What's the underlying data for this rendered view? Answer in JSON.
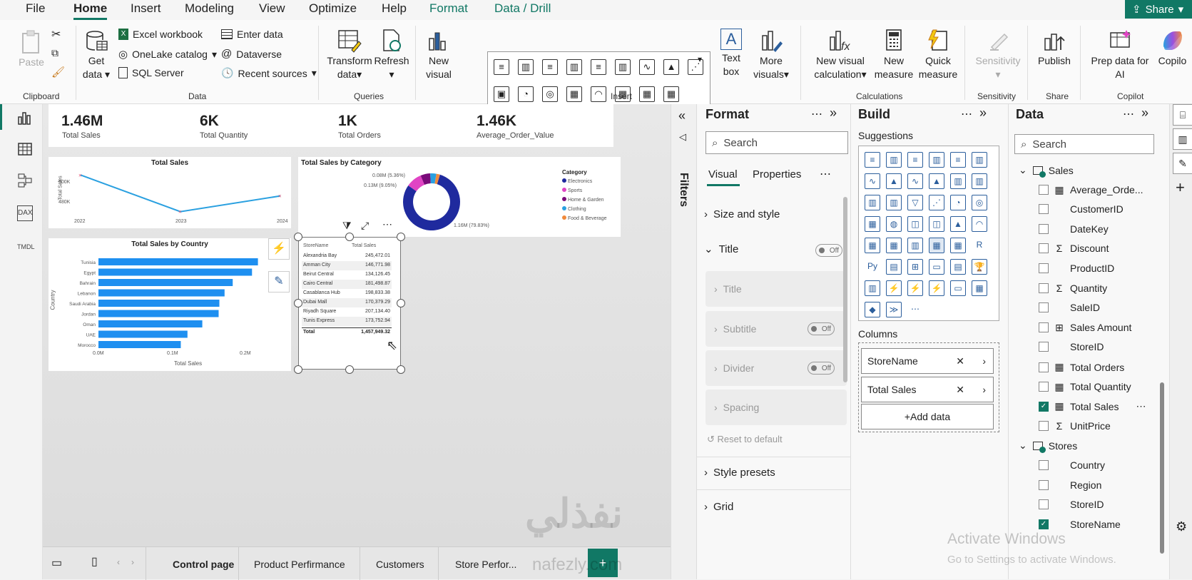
{
  "menu": {
    "file": "File",
    "home": "Home",
    "insert": "Insert",
    "modeling": "Modeling",
    "view": "View",
    "optimize": "Optimize",
    "help": "Help",
    "format": "Format",
    "data_drill": "Data / Drill",
    "share": "Share"
  },
  "ribbon": {
    "paste": "Paste",
    "clipboard": "Clipboard",
    "get_data": "Get",
    "get_data2": "data",
    "excel": "Excel workbook",
    "onelake": "OneLake catalog",
    "sql": "SQL Server",
    "enter_data": "Enter data",
    "dataverse": "Dataverse",
    "recent": "Recent sources",
    "data_group": "Data",
    "transform": "Transform",
    "transform2": "data",
    "refresh": "Refresh",
    "queries": "Queries",
    "new_visual": "New",
    "new_visual2": "visual",
    "text_box": "Text",
    "text_box2": "box",
    "more_visuals": "More",
    "more_visuals2": "visuals",
    "insert_group": "Insert",
    "new_visual_calc": "New visual",
    "new_visual_calc2": "calculation",
    "new_measure": "New",
    "new_measure2": "measure",
    "quick_measure": "Quick",
    "quick_measure2": "measure",
    "calculations": "Calculations",
    "sensitivity": "Sensitivity",
    "sensitivity_group": "Sensitivity",
    "publish": "Publish",
    "share_group": "Share",
    "copilot": "Prep data for",
    "copilot2": "AI",
    "copilot_btn": "Copilo",
    "copilot_group": "Copilot"
  },
  "leftbar": {
    "dax": "DAX",
    "tmdl": "TMDL"
  },
  "kpis": [
    {
      "value": "1.46M",
      "label": "Total Sales"
    },
    {
      "value": "6K",
      "label": "Total Quantity"
    },
    {
      "value": "1K",
      "label": "Total Orders"
    },
    {
      "value": "1.46K",
      "label": "Average_Order_Value"
    }
  ],
  "line_chart": {
    "title": "Total Sales",
    "ylabel": "Total Sales",
    "yticks": [
      "500K",
      "480K"
    ],
    "xticks": [
      "2022",
      "2023",
      "2024"
    ]
  },
  "donut": {
    "title": "Total Sales by Category",
    "legend_title": "Category",
    "labels": [
      "0.08M (5.36%)",
      "0.13M (9.05%)",
      "1.16M (79.83%)"
    ],
    "legend": [
      {
        "name": "Electronics",
        "color": "#1f2a9e"
      },
      {
        "name": "Sports",
        "color": "#e044c4"
      },
      {
        "name": "Home & Garden",
        "color": "#7a0a7a"
      },
      {
        "name": "Clothing",
        "color": "#2aa0e0"
      },
      {
        "name": "Food & Beverage",
        "color": "#f08a3c"
      }
    ]
  },
  "bar_chart": {
    "title": "Total Sales by Country",
    "ylabel": "Country",
    "xlabel": "Total Sales",
    "countries": [
      "Tunisia",
      "Egypt",
      "Bahrain",
      "Lebanon",
      "Saudi Arabia",
      "Jordan",
      "Oman",
      "UAE",
      "Morocco"
    ],
    "xticks": [
      "0.0M",
      "0.1M",
      "0.2M"
    ]
  },
  "chart_data": [
    {
      "type": "line",
      "title": "Total Sales",
      "xlabel": "",
      "ylabel": "Total Sales",
      "x": [
        "2022",
        "2023",
        "2024"
      ],
      "series": [
        {
          "values": [
            505000,
            470000,
            485000
          ]
        }
      ],
      "ylim": [
        465000,
        510000
      ]
    },
    {
      "type": "pie",
      "title": "Total Sales by Category",
      "categories": [
        "Electronics",
        "Sports",
        "Home & Garden",
        "Clothing",
        "Food & Beverage"
      ],
      "values": [
        1.16,
        0.13,
        0.08,
        0.05,
        0.03
      ]
    },
    {
      "type": "bar",
      "title": "Total Sales by Country",
      "xlabel": "Total Sales",
      "ylabel": "Country",
      "categories": [
        "Tunisia",
        "Egypt",
        "Bahrain",
        "Lebanon",
        "Saudi Arabia",
        "Jordan",
        "Oman",
        "UAE",
        "Morocco"
      ],
      "values": [
        0.215,
        0.207,
        0.181,
        0.17,
        0.163,
        0.162,
        0.14,
        0.12,
        0.111
      ],
      "xlim": [
        0,
        0.25
      ]
    }
  ],
  "table": {
    "headers": [
      "StoreName",
      "Total Sales"
    ],
    "rows": [
      [
        "Alexandria Bay",
        "245,472.01"
      ],
      [
        "Amman City",
        "146,771.98"
      ],
      [
        "Beirut Central",
        "134,126.45"
      ],
      [
        "Cairo Central",
        "181,498.87"
      ],
      [
        "Casablanca Hub",
        "198,833.38"
      ],
      [
        "Dubai Mall",
        "170,379.29"
      ],
      [
        "Riyadh Square",
        "207,134.40"
      ],
      [
        "Tunis Express",
        "173,752.94"
      ]
    ],
    "total": [
      "Total",
      "1,457,949.32"
    ]
  },
  "filters": {
    "label": "Filters"
  },
  "format": {
    "title": "Format",
    "search": "Search",
    "tab_visual": "Visual",
    "tab_properties": "Properties",
    "size_style": "Size and style",
    "title_sec": "Title",
    "off": "Off",
    "title_sub": "Title",
    "subtitle": "Subtitle",
    "divider": "Divider",
    "spacing": "Spacing",
    "reset": "Reset to default",
    "style_presets": "Style presets",
    "grid": "Grid"
  },
  "build": {
    "title": "Build",
    "suggestions": "Suggestions",
    "columns": "Columns",
    "wells": [
      "StoreName",
      "Total Sales"
    ],
    "add_data": "+Add data"
  },
  "data": {
    "title": "Data",
    "search": "Search",
    "tables": [
      {
        "name": "Sales",
        "fields": [
          {
            "name": "Average_Orde...",
            "icon": "calc",
            "checked": false
          },
          {
            "name": "CustomerID",
            "icon": "",
            "checked": false
          },
          {
            "name": "DateKey",
            "icon": "",
            "checked": false
          },
          {
            "name": "Discount",
            "icon": "sigma",
            "checked": false
          },
          {
            "name": "ProductID",
            "icon": "",
            "checked": false
          },
          {
            "name": "Quantity",
            "icon": "sigma",
            "checked": false
          },
          {
            "name": "SaleID",
            "icon": "",
            "checked": false
          },
          {
            "name": "Sales Amount",
            "icon": "hier",
            "checked": false
          },
          {
            "name": "StoreID",
            "icon": "",
            "checked": false
          },
          {
            "name": "Total Orders",
            "icon": "calc",
            "checked": false
          },
          {
            "name": "Total Quantity",
            "icon": "calc",
            "checked": false
          },
          {
            "name": "Total Sales",
            "icon": "calc",
            "checked": true
          },
          {
            "name": "UnitPrice",
            "icon": "sigma",
            "checked": false
          }
        ]
      },
      {
        "name": "Stores",
        "fields": [
          {
            "name": "Country",
            "icon": "",
            "checked": false
          },
          {
            "name": "Region",
            "icon": "",
            "checked": false
          },
          {
            "name": "StoreID",
            "icon": "",
            "checked": false
          },
          {
            "name": "StoreName",
            "icon": "",
            "checked": true
          }
        ]
      }
    ]
  },
  "pages": [
    "Control page",
    "Product Perfirmance",
    "Customers",
    "Store Perfor..."
  ],
  "watermark": {
    "activate": "Activate Windows",
    "goto": "Go to Settings to activate Windows.",
    "brand_ar": "نفذلي",
    "brand_en": "nafezly.com"
  }
}
